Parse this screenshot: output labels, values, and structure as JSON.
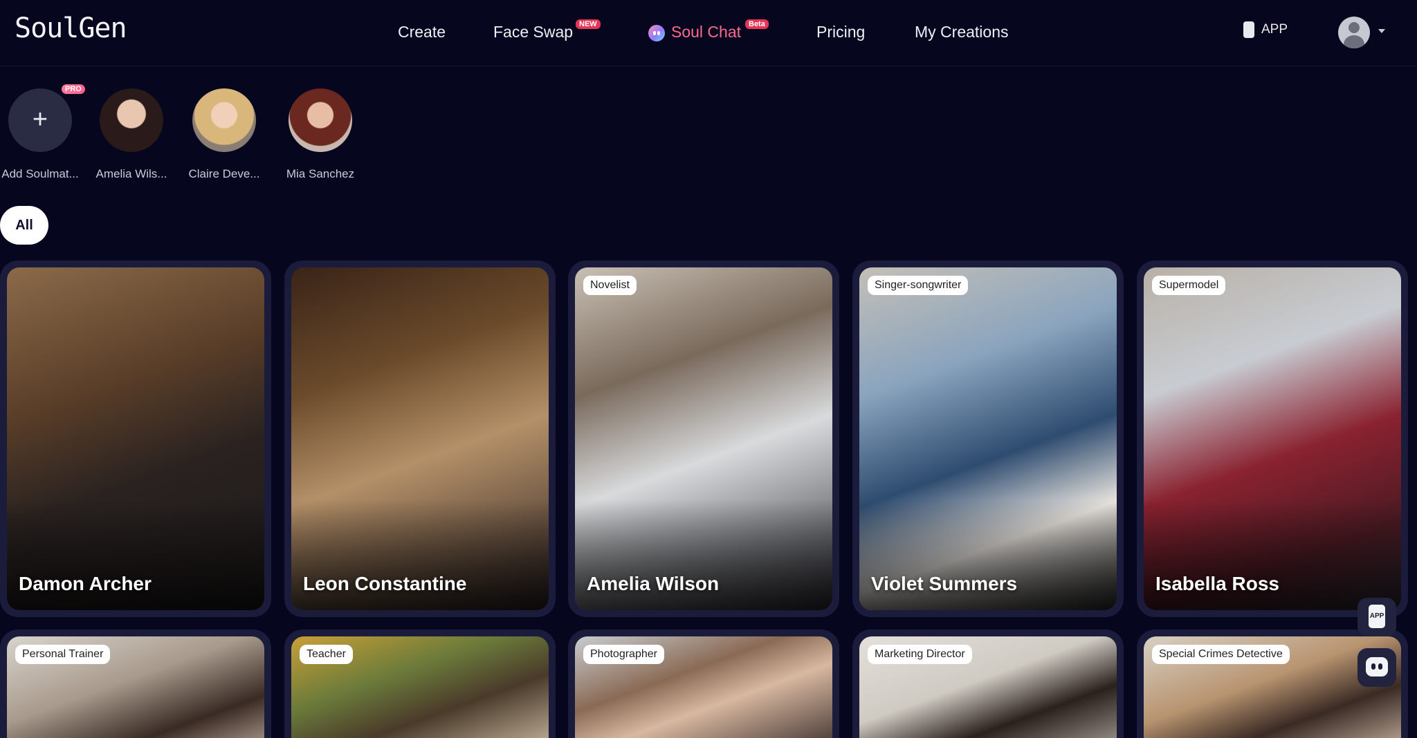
{
  "header": {
    "logo": "SoulGen",
    "nav": [
      {
        "label": "Create"
      },
      {
        "label": "Face Swap",
        "badge": "NEW"
      },
      {
        "label": "Soul Chat",
        "badge": "Beta",
        "color": "#ff6b8e"
      },
      {
        "label": "Pricing"
      },
      {
        "label": "My Creations"
      }
    ],
    "app_label": "APP"
  },
  "soulmates": [
    {
      "label": "Add Soulmat...",
      "badge": "PRO"
    },
    {
      "label": "Amelia Wils..."
    },
    {
      "label": "Claire Deve..."
    },
    {
      "label": "Mia Sanchez"
    }
  ],
  "filters": {
    "active": "All"
  },
  "cards": [
    {
      "name": "Damon Archer",
      "tag": ""
    },
    {
      "name": "Leon Constantine",
      "tag": ""
    },
    {
      "name": "Amelia Wilson",
      "tag": "Novelist"
    },
    {
      "name": "Violet Summers",
      "tag": "Singer-songwriter"
    },
    {
      "name": "Isabella Ross",
      "tag": "Supermodel"
    },
    {
      "name": "",
      "tag": "Personal Trainer"
    },
    {
      "name": "",
      "tag": "Teacher"
    },
    {
      "name": "",
      "tag": "Photographer"
    },
    {
      "name": "",
      "tag": "Marketing Director"
    },
    {
      "name": "",
      "tag": "Special Crimes Detective"
    }
  ],
  "floating": {
    "app_label": "APP"
  },
  "colors": {
    "background": "#06061e",
    "card_frame": "#1b1b3c",
    "accent": "#ff6b8e",
    "badge": "#e53556"
  }
}
